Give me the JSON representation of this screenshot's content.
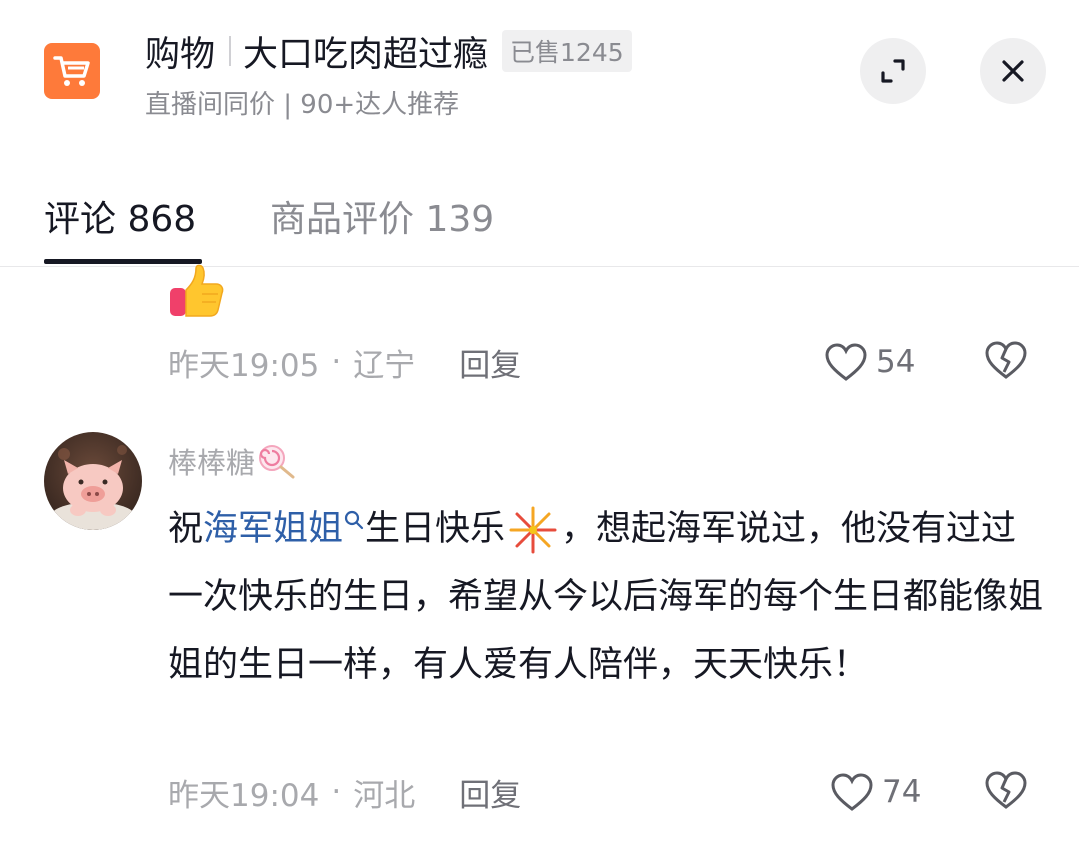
{
  "header": {
    "cart_icon": "shopping-cart-icon",
    "shop_label": "购物",
    "product_title": "大口吃肉超过瘾",
    "sold_text": "已售1245",
    "subtitle": "直播间同价 | 90+达人推荐",
    "expand_icon": "expand-icon",
    "close_icon": "close-icon",
    "accent_color": "#fe7a3a"
  },
  "tabs": [
    {
      "label": "评论 868",
      "active": true
    },
    {
      "label": "商品评价 139",
      "active": false
    }
  ],
  "comments": [
    {
      "content_emoji": "thumbs-up-emoji",
      "time": "昨天19:05",
      "separator": "·",
      "location": "辽宁",
      "reply_label": "回复",
      "likes": "54"
    },
    {
      "username": "棒棒糖",
      "username_emoji": "lollipop-emoji",
      "text_before": "祝",
      "mention": "海军姐姐",
      "text_mid": "生日快乐",
      "text_after": "，想起海军说过，他没有过过一次快乐的生日，希望从今以后海军的每个生日都能像姐姐的生日一样，有人爱有人陪伴，天天快乐！",
      "time": "昨天19:04",
      "separator": "·",
      "location": "河北",
      "reply_label": "回复",
      "likes": "74"
    }
  ]
}
